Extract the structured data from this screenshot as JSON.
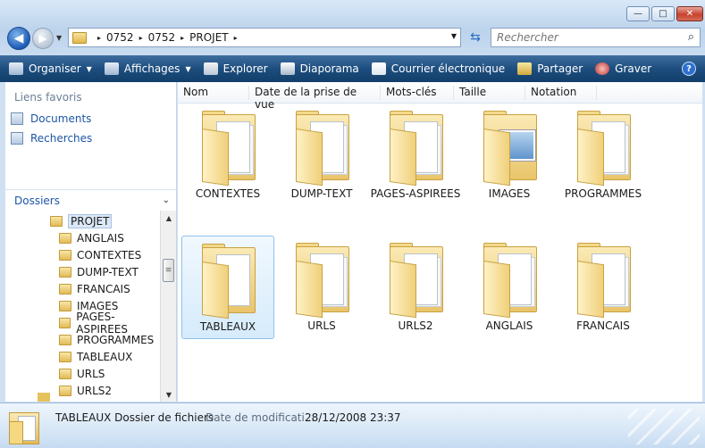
{
  "window": {
    "minimize_glyph": "—",
    "maximize_glyph": "□",
    "close_glyph": "✕"
  },
  "nav": {
    "back_glyph": "◀",
    "forward_glyph": "▶",
    "dropdown_glyph": "▼"
  },
  "address": {
    "segments": [
      "0752",
      "0752",
      "PROJET"
    ],
    "separator": "▸",
    "dropdown_glyph": "▼"
  },
  "search": {
    "placeholder": "Rechercher",
    "icon": "magnifier-icon"
  },
  "toolbar": {
    "items": [
      {
        "label": "Organiser",
        "icon": "organize-icon",
        "has_caret": true
      },
      {
        "label": "Affichages",
        "icon": "views-icon",
        "has_caret": true
      },
      {
        "label": "Explorer",
        "icon": "explore-icon",
        "has_caret": false
      },
      {
        "label": "Diaporama",
        "icon": "slideshow-icon",
        "has_caret": false
      },
      {
        "label": "Courrier électronique",
        "icon": "email-icon",
        "has_caret": false
      },
      {
        "label": "Partager",
        "icon": "share-icon",
        "has_caret": false
      },
      {
        "label": "Graver",
        "icon": "burn-icon",
        "has_caret": false
      }
    ],
    "help_glyph": "?"
  },
  "favorites": {
    "title": "Liens favoris",
    "items": [
      "Documents",
      "Recherches"
    ]
  },
  "folders": {
    "header": "Dossiers",
    "tree": [
      {
        "label": "PROJET",
        "level": 0,
        "selected": true
      },
      {
        "label": "ANGLAIS",
        "level": 1
      },
      {
        "label": "CONTEXTES",
        "level": 1
      },
      {
        "label": "DUMP-TEXT",
        "level": 1
      },
      {
        "label": "FRANCAIS",
        "level": 1
      },
      {
        "label": "IMAGES",
        "level": 1
      },
      {
        "label": "PAGES-ASPIREES",
        "level": 1
      },
      {
        "label": "PROGRAMMES",
        "level": 1
      },
      {
        "label": "TABLEAUX",
        "level": 1
      },
      {
        "label": "URLS",
        "level": 1
      },
      {
        "label": "URLS2",
        "level": 1
      }
    ],
    "scroll_up": "▲",
    "scroll_down": "▼",
    "thumb_grip": "≡"
  },
  "columns": [
    "Nom",
    "Date de la prise de vue",
    "Mots-clés",
    "Taille",
    "Notation"
  ],
  "files": [
    {
      "label": "CONTEXTES",
      "selected": false,
      "kind": "docs"
    },
    {
      "label": "DUMP-TEXT",
      "selected": false,
      "kind": "docs"
    },
    {
      "label": "PAGES-ASPIREES",
      "selected": false,
      "kind": "docs"
    },
    {
      "label": "IMAGES",
      "selected": false,
      "kind": "image"
    },
    {
      "label": "PROGRAMMES",
      "selected": false,
      "kind": "docs"
    },
    {
      "label": "TABLEAUX",
      "selected": true,
      "kind": "empty"
    },
    {
      "label": "URLS",
      "selected": false,
      "kind": "docs"
    },
    {
      "label": "URLS2",
      "selected": false,
      "kind": "docs"
    },
    {
      "label": "ANGLAIS",
      "selected": false,
      "kind": "docs"
    },
    {
      "label": "FRANCAIS",
      "selected": false,
      "kind": "docs"
    }
  ],
  "details": {
    "name": "TABLEAUX Dossier de fichiers",
    "date_label": "Date de modificati...",
    "date_value": "28/12/2008 23:37"
  },
  "colors": {
    "toolbar": "#1d4e7f",
    "link": "#1c55a7",
    "folder": "#e9c46a",
    "selection": "#d6ebfb"
  }
}
